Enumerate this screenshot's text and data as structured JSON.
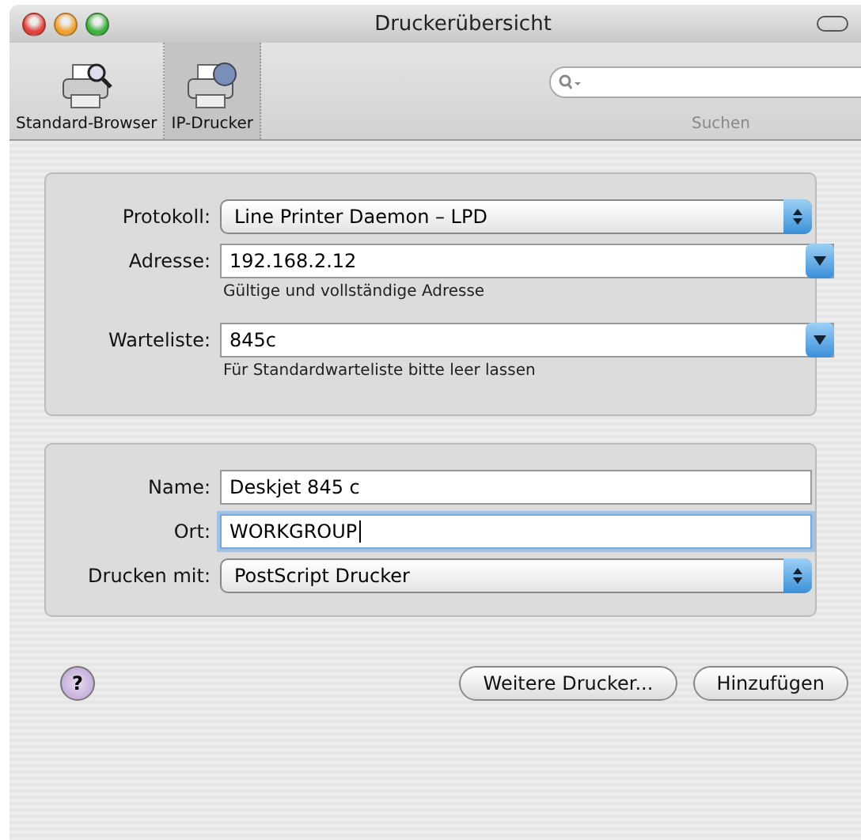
{
  "window": {
    "title": "Druckerübersicht"
  },
  "toolbar": [
    {
      "label": "Standard-Browser",
      "kind": "browser",
      "selected": false
    },
    {
      "label": "IP-Drucker",
      "kind": "ip",
      "selected": true
    }
  ],
  "search": {
    "label": "Suchen"
  },
  "panels": [
    {
      "rows": [
        {
          "label": "Protokoll:",
          "kind": "popup",
          "value": "Line Printer Daemon – LPD"
        },
        {
          "label": "Adresse:",
          "kind": "combo",
          "value": "192.168.2.12",
          "hint": "Gültige und vollständige Adresse"
        },
        {
          "label": "Warteliste:",
          "kind": "combo",
          "value": "845c",
          "hint": "Für Standardwarteliste bitte leer lassen"
        }
      ]
    },
    {
      "rows": [
        {
          "label": "Name:",
          "kind": "text",
          "value": "Deskjet 845 c",
          "focused": false
        },
        {
          "label": "Ort:",
          "kind": "text",
          "value": "WORKGROUP",
          "focused": true
        },
        {
          "label": "Drucken mit:",
          "kind": "popup",
          "value": "PostScript Drucker"
        }
      ]
    }
  ],
  "help": {
    "label": "?"
  },
  "buttons": [
    "Weitere Drucker...",
    "Hinzufügen"
  ]
}
